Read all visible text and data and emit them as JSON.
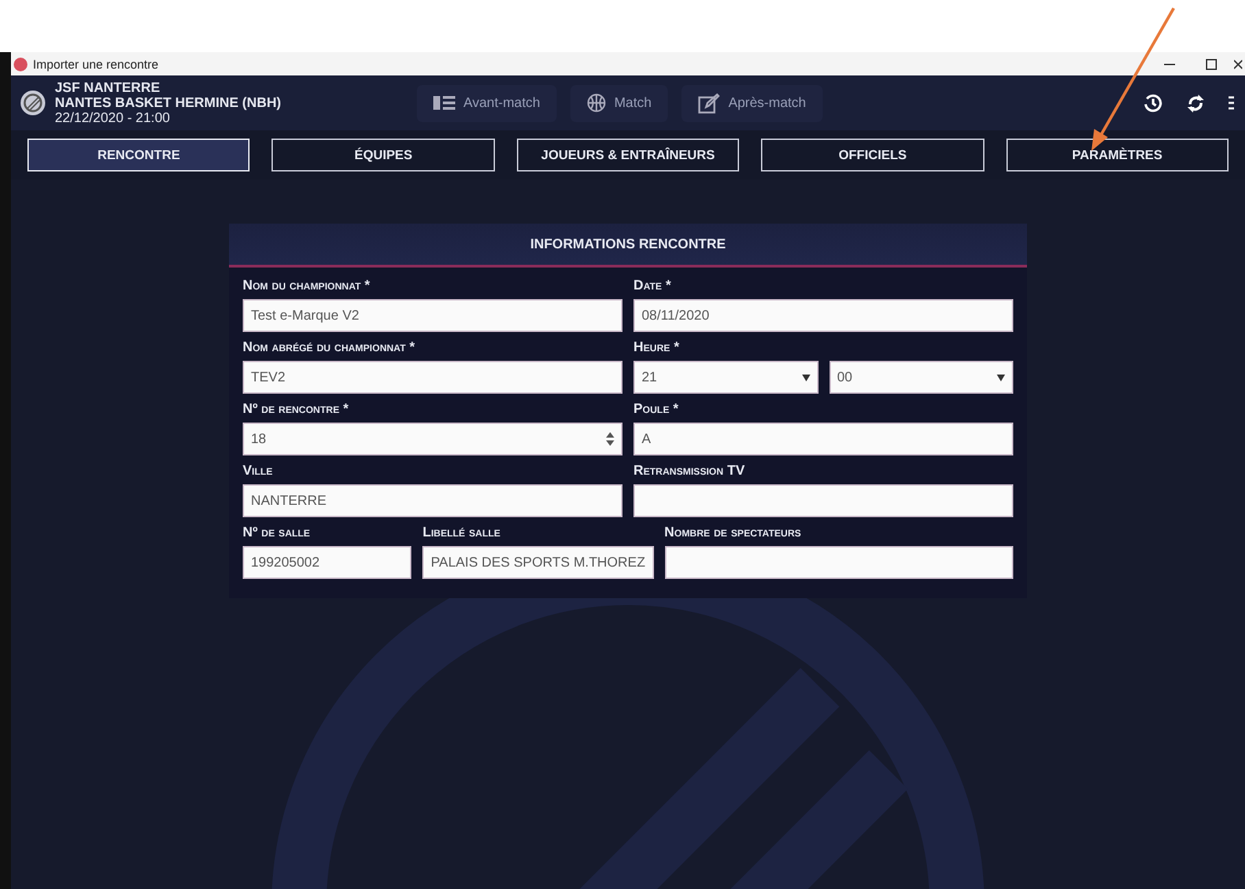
{
  "window": {
    "title": "Importer une rencontre"
  },
  "match": {
    "home": "JSF NANTERRE",
    "away": "NANTES BASKET HERMINE (NBH)",
    "datetime": "22/12/2020 - 21:00"
  },
  "phases": [
    {
      "label": "Avant-match",
      "kind": "list"
    },
    {
      "label": "Match",
      "kind": "ball"
    },
    {
      "label": "Après-match",
      "kind": "edit"
    }
  ],
  "tabs": [
    {
      "label": "RENCONTRE",
      "selected": true
    },
    {
      "label": "ÉQUIPES",
      "selected": false
    },
    {
      "label": "JOUEURS & ENTRAÎNEURS",
      "selected": false
    },
    {
      "label": "OFFICIELS",
      "selected": false
    },
    {
      "label": "PARAMÈTRES",
      "selected": false
    }
  ],
  "form": {
    "title": "INFORMATIONS RENCONTRE",
    "rows": [
      [
        {
          "label": "Nom du championnat *",
          "kind": "text",
          "value": "Test e-Marque V2"
        },
        {
          "label": "Date *",
          "kind": "text",
          "value": "08/11/2020"
        }
      ],
      [
        {
          "label": "Nom abrégé du championnat *",
          "kind": "text",
          "value": "TEV2"
        },
        {
          "label": "Heure *",
          "kind": "time",
          "values": [
            "21",
            "00"
          ]
        }
      ],
      [
        {
          "label": "Nº de rencontre *",
          "kind": "number",
          "value": "18"
        },
        {
          "label": "Poule *",
          "kind": "text",
          "value": "A"
        }
      ],
      [
        {
          "label": "Ville",
          "kind": "text",
          "value": "NANTERRE"
        },
        {
          "label": "Retransmission TV",
          "kind": "text"
        }
      ],
      [
        {
          "label": "Nº de salle",
          "kind": "text",
          "value": "199205002"
        },
        {
          "label": "Libellé salle",
          "kind": "text",
          "value": "PALAIS DES SPORTS M.THOREZ"
        },
        {
          "label": "Nombre de spectateurs",
          "kind": "text"
        }
      ]
    ]
  }
}
